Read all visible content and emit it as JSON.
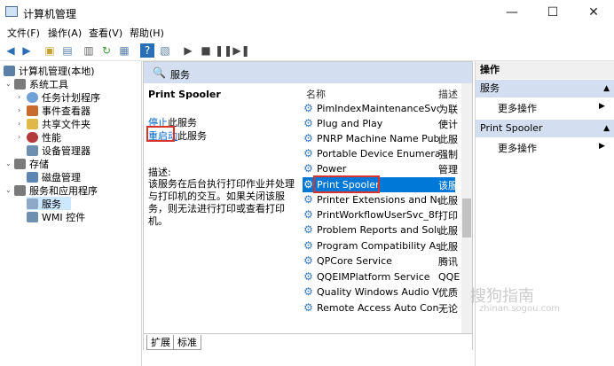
{
  "window": {
    "title": "计算机管理",
    "minimize": "—",
    "maximize": "☐",
    "close": "✕"
  },
  "menu": [
    "文件(F)",
    "操作(A)",
    "查看(V)",
    "帮助(H)"
  ],
  "toolbar": [
    "back-icon",
    "forward-icon",
    "up-icon",
    "tree-icon",
    "export-icon",
    "refresh-icon",
    "properties-icon",
    "help-icon",
    "view-icon",
    "play-icon",
    "stop-icon",
    "pause-icon",
    "restart-icon"
  ],
  "tree": [
    {
      "label": "计算机管理(本地)",
      "level": 0,
      "icon_color": "#5b7fa6"
    },
    {
      "label": "系统工具",
      "level": 1,
      "icon_color": "#7a7a7a",
      "arrow": "⌄"
    },
    {
      "label": "任务计划程序",
      "level": 2,
      "icon_color": "#6fa0d6",
      "arrow": "›"
    },
    {
      "label": "事件查看器",
      "level": 2,
      "icon_color": "#c86b2e",
      "arrow": "›"
    },
    {
      "label": "共享文件夹",
      "level": 2,
      "icon_color": "#e0b84a",
      "arrow": "›"
    },
    {
      "label": "性能",
      "level": 2,
      "icon_color": "#b33a3a",
      "arrow": "›"
    },
    {
      "label": "设备管理器",
      "level": 2,
      "icon_color": "#6f8fb0"
    },
    {
      "label": "存储",
      "level": 1,
      "icon_color": "#7a7a7a",
      "arrow": "⌄"
    },
    {
      "label": "磁盘管理",
      "level": 2,
      "icon_color": "#5e86b3"
    },
    {
      "label": "服务和应用程序",
      "level": 1,
      "icon_color": "#7a7a7a",
      "arrow": "⌄"
    },
    {
      "label": "服务",
      "level": 2,
      "icon_color": "#8fa8c8",
      "selected": true
    },
    {
      "label": "WMI 控件",
      "level": 2,
      "icon_color": "#6f8fb0"
    }
  ],
  "center": {
    "header": "服务",
    "service_name": "Print Spooler",
    "stop_link": "停止",
    "stop_suffix": "此服务",
    "restart_link": "重启动",
    "restart_suffix": "此服务",
    "desc_label": "描述:",
    "desc_text": "该服务在后台执行打印作业并处理与打印机的交互。如果关闭该服务，则无法进行打印或查看打印机。",
    "columns": {
      "name": "名称",
      "desc": "描述"
    },
    "services": [
      {
        "name": "PimIndexMaintenanceSvc_...",
        "desc": "为联"
      },
      {
        "name": "Plug and Play",
        "desc": "使计"
      },
      {
        "name": "PNRP Machine Name Publ...",
        "desc": "此服"
      },
      {
        "name": "Portable Device Enumerat...",
        "desc": "强制"
      },
      {
        "name": "Power",
        "desc": "管理"
      },
      {
        "name": "Print Spooler",
        "desc": "该服",
        "selected": true
      },
      {
        "name": "Printer Extensions and Noti...",
        "desc": "此服"
      },
      {
        "name": "PrintWorkflowUserSvc_8f3",
        "desc": "打印"
      },
      {
        "name": "Problem Reports and Solut...",
        "desc": "此服"
      },
      {
        "name": "Program Compatibility Assi...",
        "desc": "此服"
      },
      {
        "name": "QPCore Service",
        "desc": "腾讯"
      },
      {
        "name": "QQEIMPlatform Service",
        "desc": "QQE"
      },
      {
        "name": "Quality Windows Audio Vi...",
        "desc": "优质"
      },
      {
        "name": "Remote Access Auto Conn...",
        "desc": "无论"
      }
    ],
    "tabs": [
      "扩展",
      "标准"
    ]
  },
  "actions": {
    "title": "操作",
    "sections": [
      {
        "label": "服务",
        "item": "更多操作"
      },
      {
        "label": "Print Spooler",
        "item": "更多操作"
      }
    ]
  },
  "watermark": {
    "main": "搜狗指南",
    "sub": "zhinan.sogou.com"
  }
}
